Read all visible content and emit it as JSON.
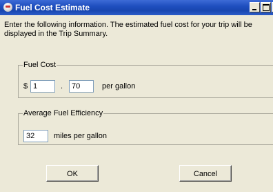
{
  "window": {
    "title": "Fuel Cost Estimate"
  },
  "intro_text": "Enter the following information.  The estimated fuel cost for your trip will be displayed in the Trip Summary.",
  "fuel_cost": {
    "legend": "Fuel Cost",
    "currency_symbol": "$",
    "dollars_value": "1",
    "separator": ".",
    "cents_value": "70",
    "unit_label": "per gallon"
  },
  "efficiency": {
    "legend": "Average Fuel Efficiency",
    "value": "32",
    "unit_label": "miles per gallon"
  },
  "buttons": {
    "ok": "OK",
    "cancel": "Cancel"
  }
}
